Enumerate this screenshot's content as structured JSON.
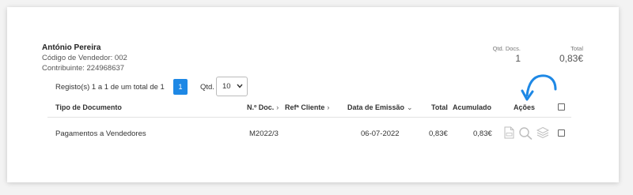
{
  "seller": {
    "name": "António Pereira",
    "code_line": "Código de Vendedor: 002",
    "taxid_line": "Contribuinte: 224968637"
  },
  "summary": {
    "docs_label": "Qtd. Docs.",
    "docs_value": "1",
    "total_label": "Total",
    "total_value": "0,83€"
  },
  "pagination": {
    "records_info": "Registo(s) 1 a 1 de um total de 1",
    "current_page": "1",
    "qty_label": "Qtd.",
    "qty_value": "10"
  },
  "table": {
    "headers": {
      "doc_type": "Tipo de Documento",
      "doc_number": "N.º Doc.",
      "client_ref": "Refª Cliente",
      "issue_date": "Data de Emissão",
      "total": "Total",
      "accumulated": "Acumulado",
      "actions": "Ações"
    },
    "rows": [
      {
        "doc_type": "Pagamentos a Vendedores",
        "doc_number": "M2022/3",
        "issue_date": "06-07-2022",
        "total": "0,83€",
        "accumulated": "0,83€"
      }
    ]
  },
  "icons": {
    "pdf": "pdf-file-icon",
    "search": "magnifier-icon",
    "layers": "layers-icon",
    "arrow": "curved-arrow-icon"
  },
  "colors": {
    "accent": "#1e88e5",
    "icon_gray": "#bdbdbd"
  }
}
